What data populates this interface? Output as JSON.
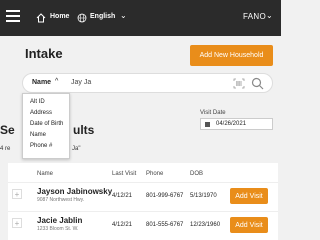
{
  "nav": {
    "home_label": "Home",
    "language_label": "English",
    "org_label": "FANO",
    "icons": [
      "hamburger-menu-icon",
      "home-icon",
      "globe-icon",
      "chevron-down-icon"
    ]
  },
  "header": {
    "title": "Intake",
    "add_household_label": "Add New Household"
  },
  "search": {
    "field_selected": "Name",
    "value": "Jay Ja",
    "field_options": [
      "Alt ID",
      "Address",
      "Date of Birth",
      "Name",
      "Phone #"
    ]
  },
  "visit_date": {
    "label": "Visit Date",
    "value": "04/26/2021"
  },
  "results": {
    "title_visible_start": "Se",
    "title_visible_end": "ults",
    "count_visible_start": "4 re",
    "count_visible_end": "Ja\"",
    "columns": [
      "Name",
      "Last Visit",
      "Phone",
      "DOB"
    ],
    "rows": [
      {
        "name": "Jayson Jabinowsky",
        "address": "9087 Northwest Hwy.",
        "last_visit": "4/12/21",
        "phone": "801-999-6767",
        "dob": "5/13/1970",
        "action": "Add Visit"
      },
      {
        "name": "Jacie Jablin",
        "address": "1233 Bloom St. W.",
        "last_visit": "4/12/21",
        "phone": "801-555-6767",
        "dob": "12/23/1960",
        "action": "Add Visit"
      }
    ]
  },
  "colors": {
    "accent": "#e98d1a",
    "topbar": "#2b2b2b",
    "background": "#f1f1f1"
  }
}
